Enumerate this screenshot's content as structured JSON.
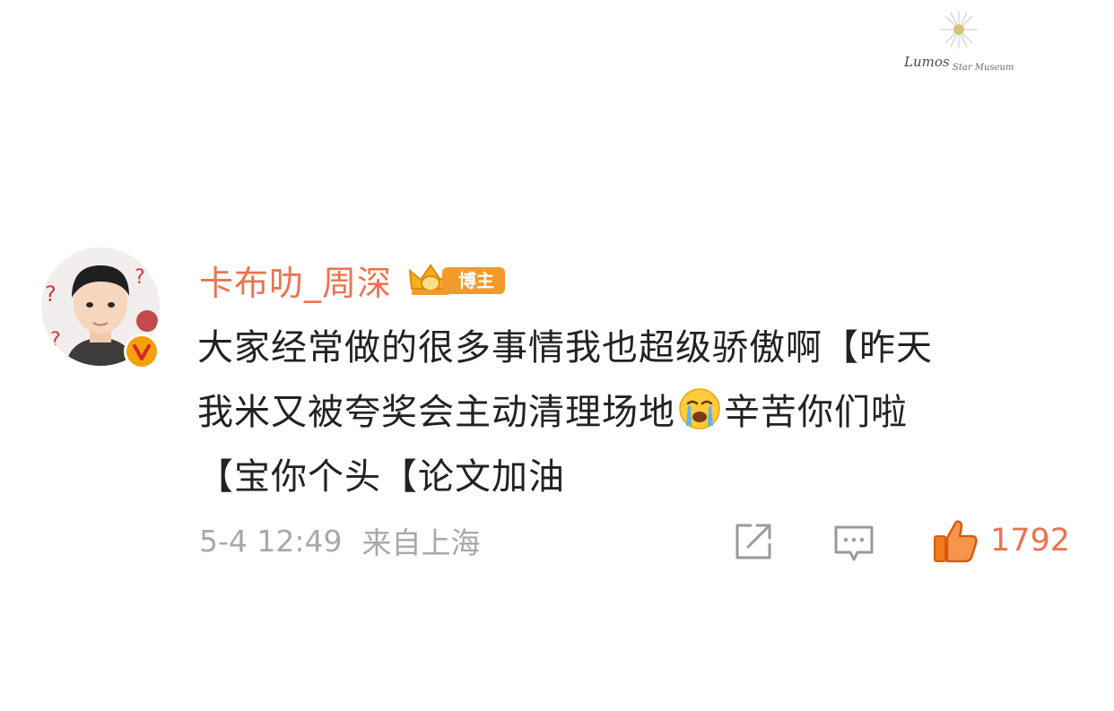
{
  "watermark": {
    "text": "Lumos",
    "subtext": "Star Museum"
  },
  "comment": {
    "username": "卡布叻_周深",
    "badge_label": "博主",
    "text_lines": [
      "大家经常做的很多事情我也超级骄傲啊【昨天",
      "我米又被夸奖会主动清理场地",
      "辛苦你们啦",
      "【宝你个头【论文加油"
    ],
    "timestamp": "5-4 12:49",
    "source": "来自上海",
    "like_count": "1792"
  },
  "colors": {
    "username": "#eb7350",
    "text": "#222222",
    "meta": "#a8a8a8",
    "badge": "#f39a2a",
    "like_icon": "#f07b1e"
  },
  "icons": {
    "share": "share-icon",
    "reply": "reply-icon",
    "like": "thumbs-up-icon",
    "emoji": "crying-face-icon",
    "verified": "verified-v-icon",
    "crown": "crown-icon"
  }
}
